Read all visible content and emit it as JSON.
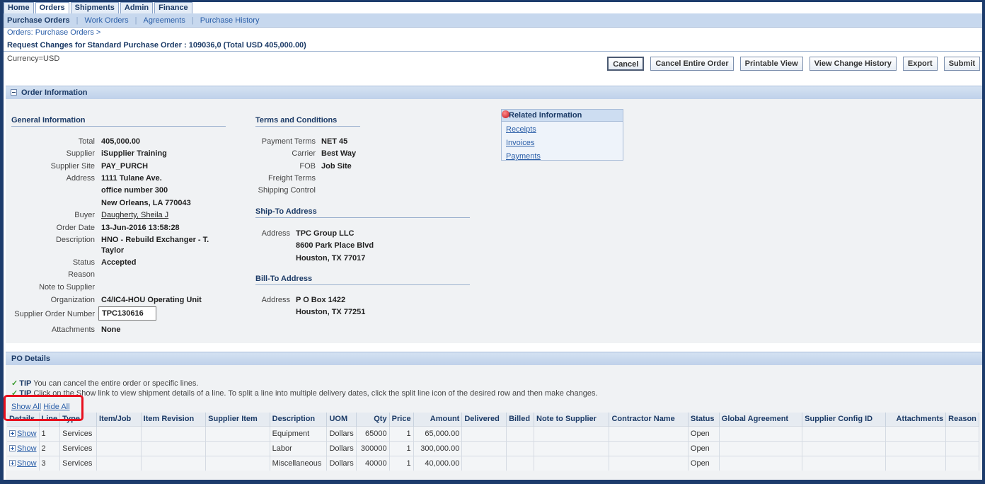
{
  "tabs": [
    "Home",
    "Orders",
    "Shipments",
    "Admin",
    "Finance"
  ],
  "subnav": [
    "Purchase Orders",
    "Work Orders",
    "Agreements",
    "Purchase History"
  ],
  "breadcrumb": "Orders: Purchase Orders  >",
  "page_title": "Request Changes for Standard Purchase Order : 109036,0 (Total USD 405,000.00)",
  "currency": "Currency=USD",
  "buttons": {
    "cancel": "Cancel",
    "cancel_entire": "Cancel Entire Order",
    "printable": "Printable View",
    "history": "View Change History",
    "export": "Export",
    "submit": "Submit"
  },
  "order_info": {
    "header": "Order Information",
    "general": {
      "header": "General Information",
      "total_label": "Total",
      "total": "405,000.00",
      "supplier_label": "Supplier",
      "supplier": "iSupplier Training",
      "site_label": "Supplier Site",
      "site": "PAY_PURCH",
      "address_label": "Address",
      "address1": "1111 Tulane Ave.",
      "address2": "office number 300",
      "address3": "New Orleans, LA 770043",
      "buyer_label": "Buyer",
      "buyer": "Daugherty, Sheila J",
      "order_date_label": "Order Date",
      "order_date": "13-Jun-2016 13:58:28",
      "description_label": "Description",
      "description1": "HNO - Rebuild Exchanger - T.",
      "description2": "Taylor",
      "status_label": "Status",
      "status": "Accepted",
      "reason_label": "Reason",
      "note_label": "Note to Supplier",
      "org_label": "Organization",
      "org": "C4/IC4-HOU Operating Unit",
      "son_label": "Supplier Order Number",
      "son": "TPC130616",
      "attachments_label": "Attachments",
      "attachments": "None"
    },
    "terms": {
      "header": "Terms and Conditions",
      "payment_label": "Payment Terms",
      "payment": "NET 45",
      "carrier_label": "Carrier",
      "carrier": "Best Way",
      "fob_label": "FOB",
      "fob": "Job Site",
      "freight_label": "Freight Terms",
      "shipping_label": "Shipping Control"
    },
    "ship_to": {
      "header": "Ship-To Address",
      "label": "Address",
      "line1": "TPC Group LLC",
      "line2": "8600 Park Place Blvd",
      "line3": "Houston, TX 77017"
    },
    "bill_to": {
      "header": "Bill-To Address",
      "label": "Address",
      "line1": "P O Box 1422",
      "line2": "Houston, TX 77251"
    },
    "related": {
      "header": "Related Information",
      "links": [
        "Receipts",
        "Invoices",
        "Payments"
      ]
    }
  },
  "po_details": {
    "header": "PO Details",
    "tip_label": "TIP",
    "tip1": "You can cancel the entire order or specific lines.",
    "tip2": "Click on the Show link to view shipment details of a line. To split a line into multiple delivery dates, click the split line icon of the desired row and then make changes.",
    "show_all": "Show All",
    "hide_all": "Hide All",
    "columns": [
      "Details",
      "Line",
      "Type",
      "Item/Job",
      "Item Revision",
      "Supplier Item",
      "Description",
      "UOM",
      "Qty",
      "Price",
      "Amount",
      "Delivered",
      "Billed",
      "Note to Supplier",
      "Contractor Name",
      "Status",
      "Global Agreement",
      "Supplier Config ID",
      "Attachments",
      "Reason"
    ],
    "rows": [
      {
        "show": "Show",
        "line": "1",
        "type": "Services",
        "description": "Equipment",
        "uom": "Dollars",
        "qty": "65000",
        "price": "1",
        "amount": "65,000.00",
        "status": "Open"
      },
      {
        "show": "Show",
        "line": "2",
        "type": "Services",
        "description": "Labor",
        "uom": "Dollars",
        "qty": "300000",
        "price": "1",
        "amount": "300,000.00",
        "status": "Open"
      },
      {
        "show": "Show",
        "line": "3",
        "type": "Services",
        "description": "Miscellaneous",
        "uom": "Dollars",
        "qty": "40000",
        "price": "1",
        "amount": "40,000.00",
        "status": "Open"
      }
    ]
  },
  "colors": {
    "highlight": "#e8101e",
    "frame": "#1d3c6c",
    "link": "#2a5ea8"
  }
}
